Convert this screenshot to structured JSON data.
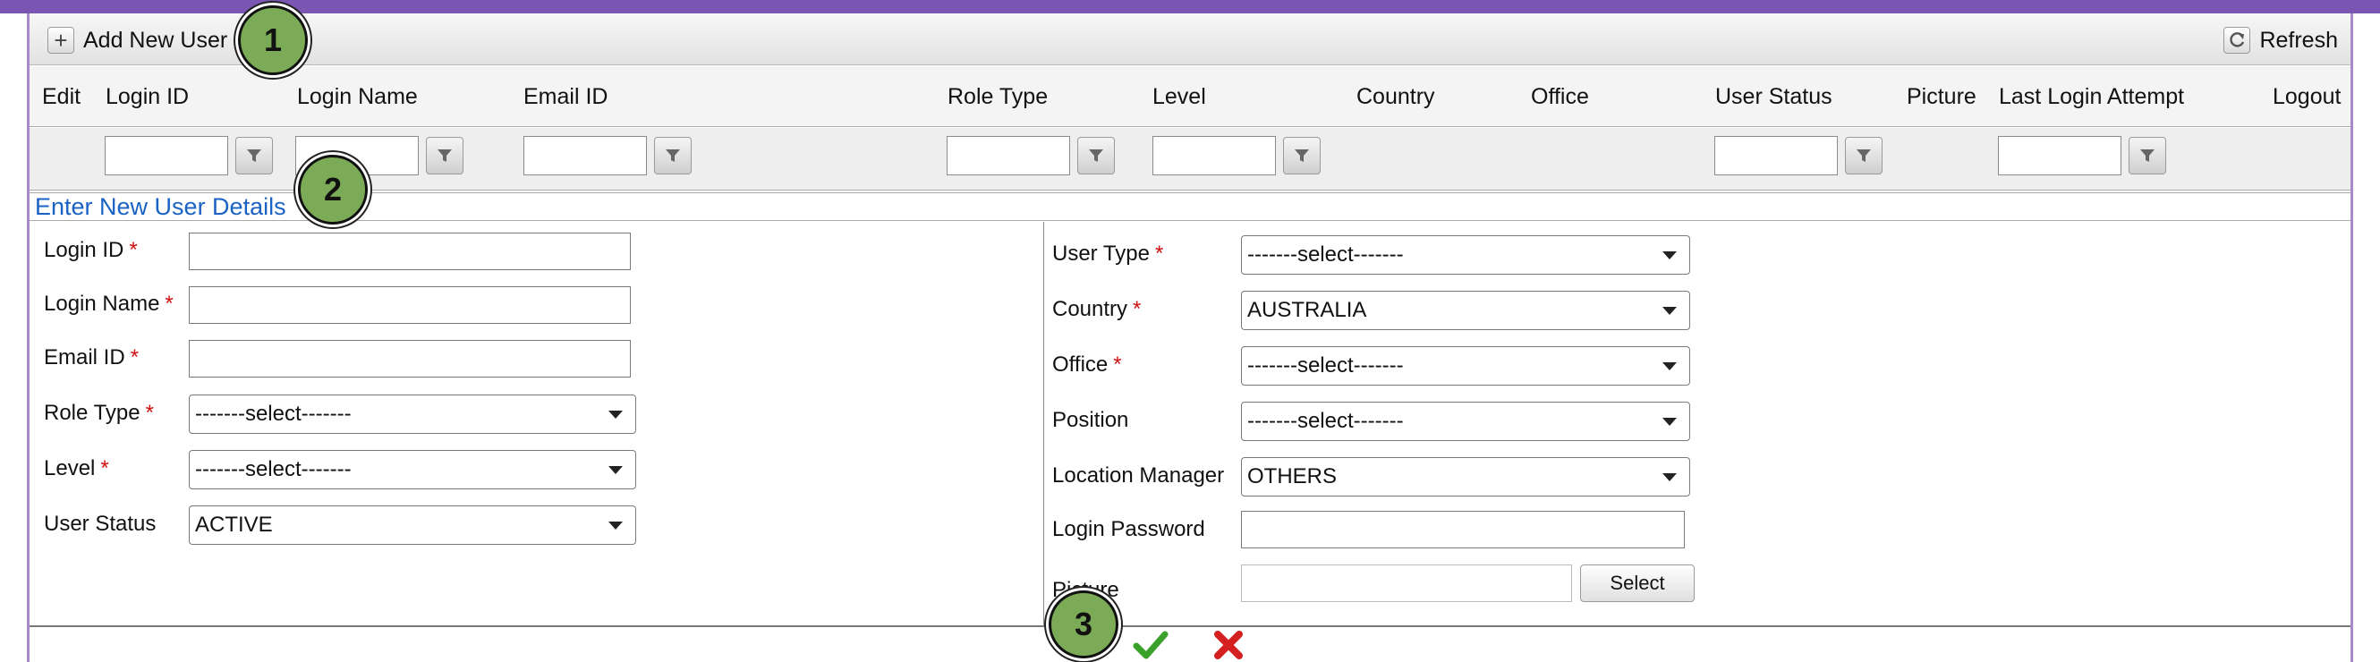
{
  "toolbar": {
    "add_label": "Add New User",
    "refresh_label": "Refresh"
  },
  "grid": {
    "columns": [
      "Edit",
      "Login ID",
      "Login Name",
      "Email ID",
      "Role Type",
      "Level",
      "Country",
      "Office",
      "User Status",
      "Picture",
      "Last Login Attempt",
      "Logout"
    ]
  },
  "section": {
    "title": "Enter New User Details"
  },
  "form": {
    "login_id_label": "Login ID",
    "login_name_label": "Login Name",
    "email_id_label": "Email ID",
    "role_type_label": "Role Type",
    "role_type_value": "-------select-------",
    "level_label": "Level",
    "level_value": "-------select-------",
    "user_status_label": "User Status",
    "user_status_value": "ACTIVE",
    "user_type_label": "User Type",
    "user_type_value": "-------select-------",
    "country_label": "Country",
    "country_value": "AUSTRALIA",
    "office_label": "Office",
    "office_value": "-------select-------",
    "position_label": "Position",
    "position_value": "-------select-------",
    "location_manager_label": "Location Manager",
    "location_manager_value": "OTHERS",
    "login_password_label": "Login Password",
    "picture_label": "Picture",
    "picture_select_label": "Select",
    "required_mark": "*"
  },
  "markers": [
    "1",
    "2",
    "3"
  ],
  "colors": {
    "topbar": "#7a55b1",
    "frame_border": "#a68acc",
    "section_title": "#1a63c4",
    "required": "#d01010",
    "marker_fill": "#7cab58",
    "save": "#3aa12a",
    "cancel": "#d42020"
  },
  "icons": {
    "add": "plus-icon",
    "refresh": "refresh-icon",
    "filter": "filter-icon",
    "save": "checkmark-icon",
    "cancel": "cross-icon"
  }
}
